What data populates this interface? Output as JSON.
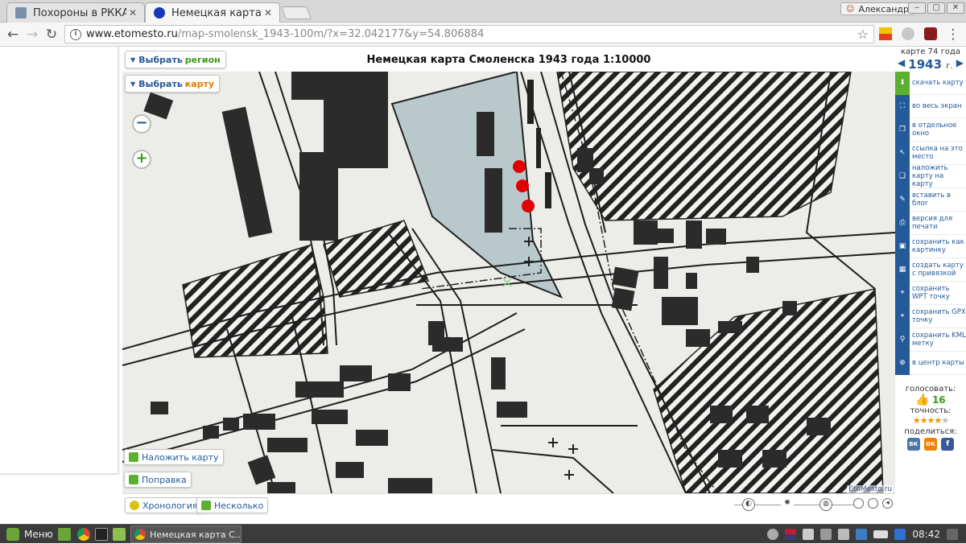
{
  "browser": {
    "tabs": [
      {
        "title": "Похороны в РККА",
        "active": false
      },
      {
        "title": "Немецкая карта С",
        "active": true
      }
    ],
    "user": "Александр",
    "window_buttons": {
      "minimize": "‒",
      "maximize": "▢",
      "close": "✕"
    },
    "url_host": "www.etomesto.ru",
    "url_path": "/map-smolensk_1943-100m/?x=32.042177&y=54.806884"
  },
  "map": {
    "title": "Немецкая карта Смоленска 1943 года 1:10000",
    "select_region": {
      "prefix": "Выбрать",
      "word": "регион"
    },
    "select_map": {
      "prefix": "Выбрать",
      "word": "карту"
    },
    "zoom_out": "−",
    "zoom_in": "+",
    "overlay_button": "Наложить карту",
    "correction_button": "Поправка",
    "chronology_button": "Хронология",
    "several_button": "Несколько",
    "credit": "EtoMesto.ru"
  },
  "sidebar": {
    "older_label": "карте 74 года",
    "year": "1943",
    "year_suffix": "г.",
    "items": [
      "скачать карту",
      "во весь экран",
      "в отдельное окно",
      "ссылка на это место",
      "наложить карту на карту",
      "вставить в блог",
      "версия для печати",
      "сохранить как картинку",
      "создать карту с привязкой",
      "сохранить WPT точку",
      "сохранить GPX точку",
      "сохранить KML метку",
      "в центр карты"
    ],
    "vote_label": "голосовать:",
    "vote_count": "16",
    "accuracy_label": "точность:",
    "share_label": "поделиться:",
    "share": [
      "ВК",
      "ОК",
      "f"
    ]
  },
  "taskbar": {
    "menu": "Меню",
    "window_title": "Немецкая карта С...",
    "time": "08:42"
  },
  "colors": {
    "accent": "#245a9a",
    "green": "#5bb12f",
    "marker": "#e00000"
  }
}
